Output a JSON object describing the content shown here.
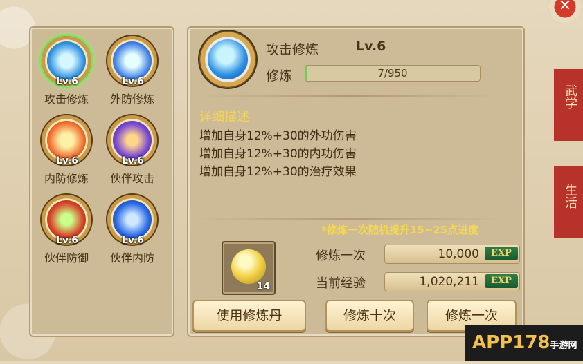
{
  "skills": [
    {
      "name": "攻击修炼",
      "level": "Lv.6",
      "color": "#3aa5e6",
      "active": true
    },
    {
      "name": "外防修炼",
      "level": "Lv.6",
      "color": "#3a7de6"
    },
    {
      "name": "内防修炼",
      "level": "Lv.6",
      "color": "#e65b2a"
    },
    {
      "name": "伙伴攻击",
      "level": "Lv.6",
      "color": "#5a3ad6"
    },
    {
      "name": "伙伴防御",
      "level": "Lv.6",
      "color": "#d94a2a"
    },
    {
      "name": "伙伴内防",
      "level": "Lv.6",
      "color": "#2a6ae6"
    }
  ],
  "detail": {
    "title": "攻击修炼",
    "level": "Lv.6",
    "train_label": "修炼",
    "progress_text": "7/950",
    "progress_fraction": 0.0074
  },
  "description": {
    "title": "详细描述",
    "lines": [
      "增加自身12%+30的外功伤害",
      "增加自身12%+30的内功伤害",
      "增加自身12%+30的治疗效果"
    ]
  },
  "hint": "*修炼一次随机提升15~25点进度",
  "item": {
    "count": "14"
  },
  "rows": {
    "once_label": "修炼一次",
    "once_value": "10,000",
    "current_label": "当前经验",
    "current_value": "1,020,211",
    "exp_tag": "EXP"
  },
  "buttons": {
    "use_pill": "使用修炼丹",
    "train_ten": "修炼十次",
    "train_once": "修炼一次"
  },
  "side_tabs": [
    "武学",
    "生活"
  ],
  "watermark": {
    "main": "APP178",
    "sub": "手游网"
  }
}
